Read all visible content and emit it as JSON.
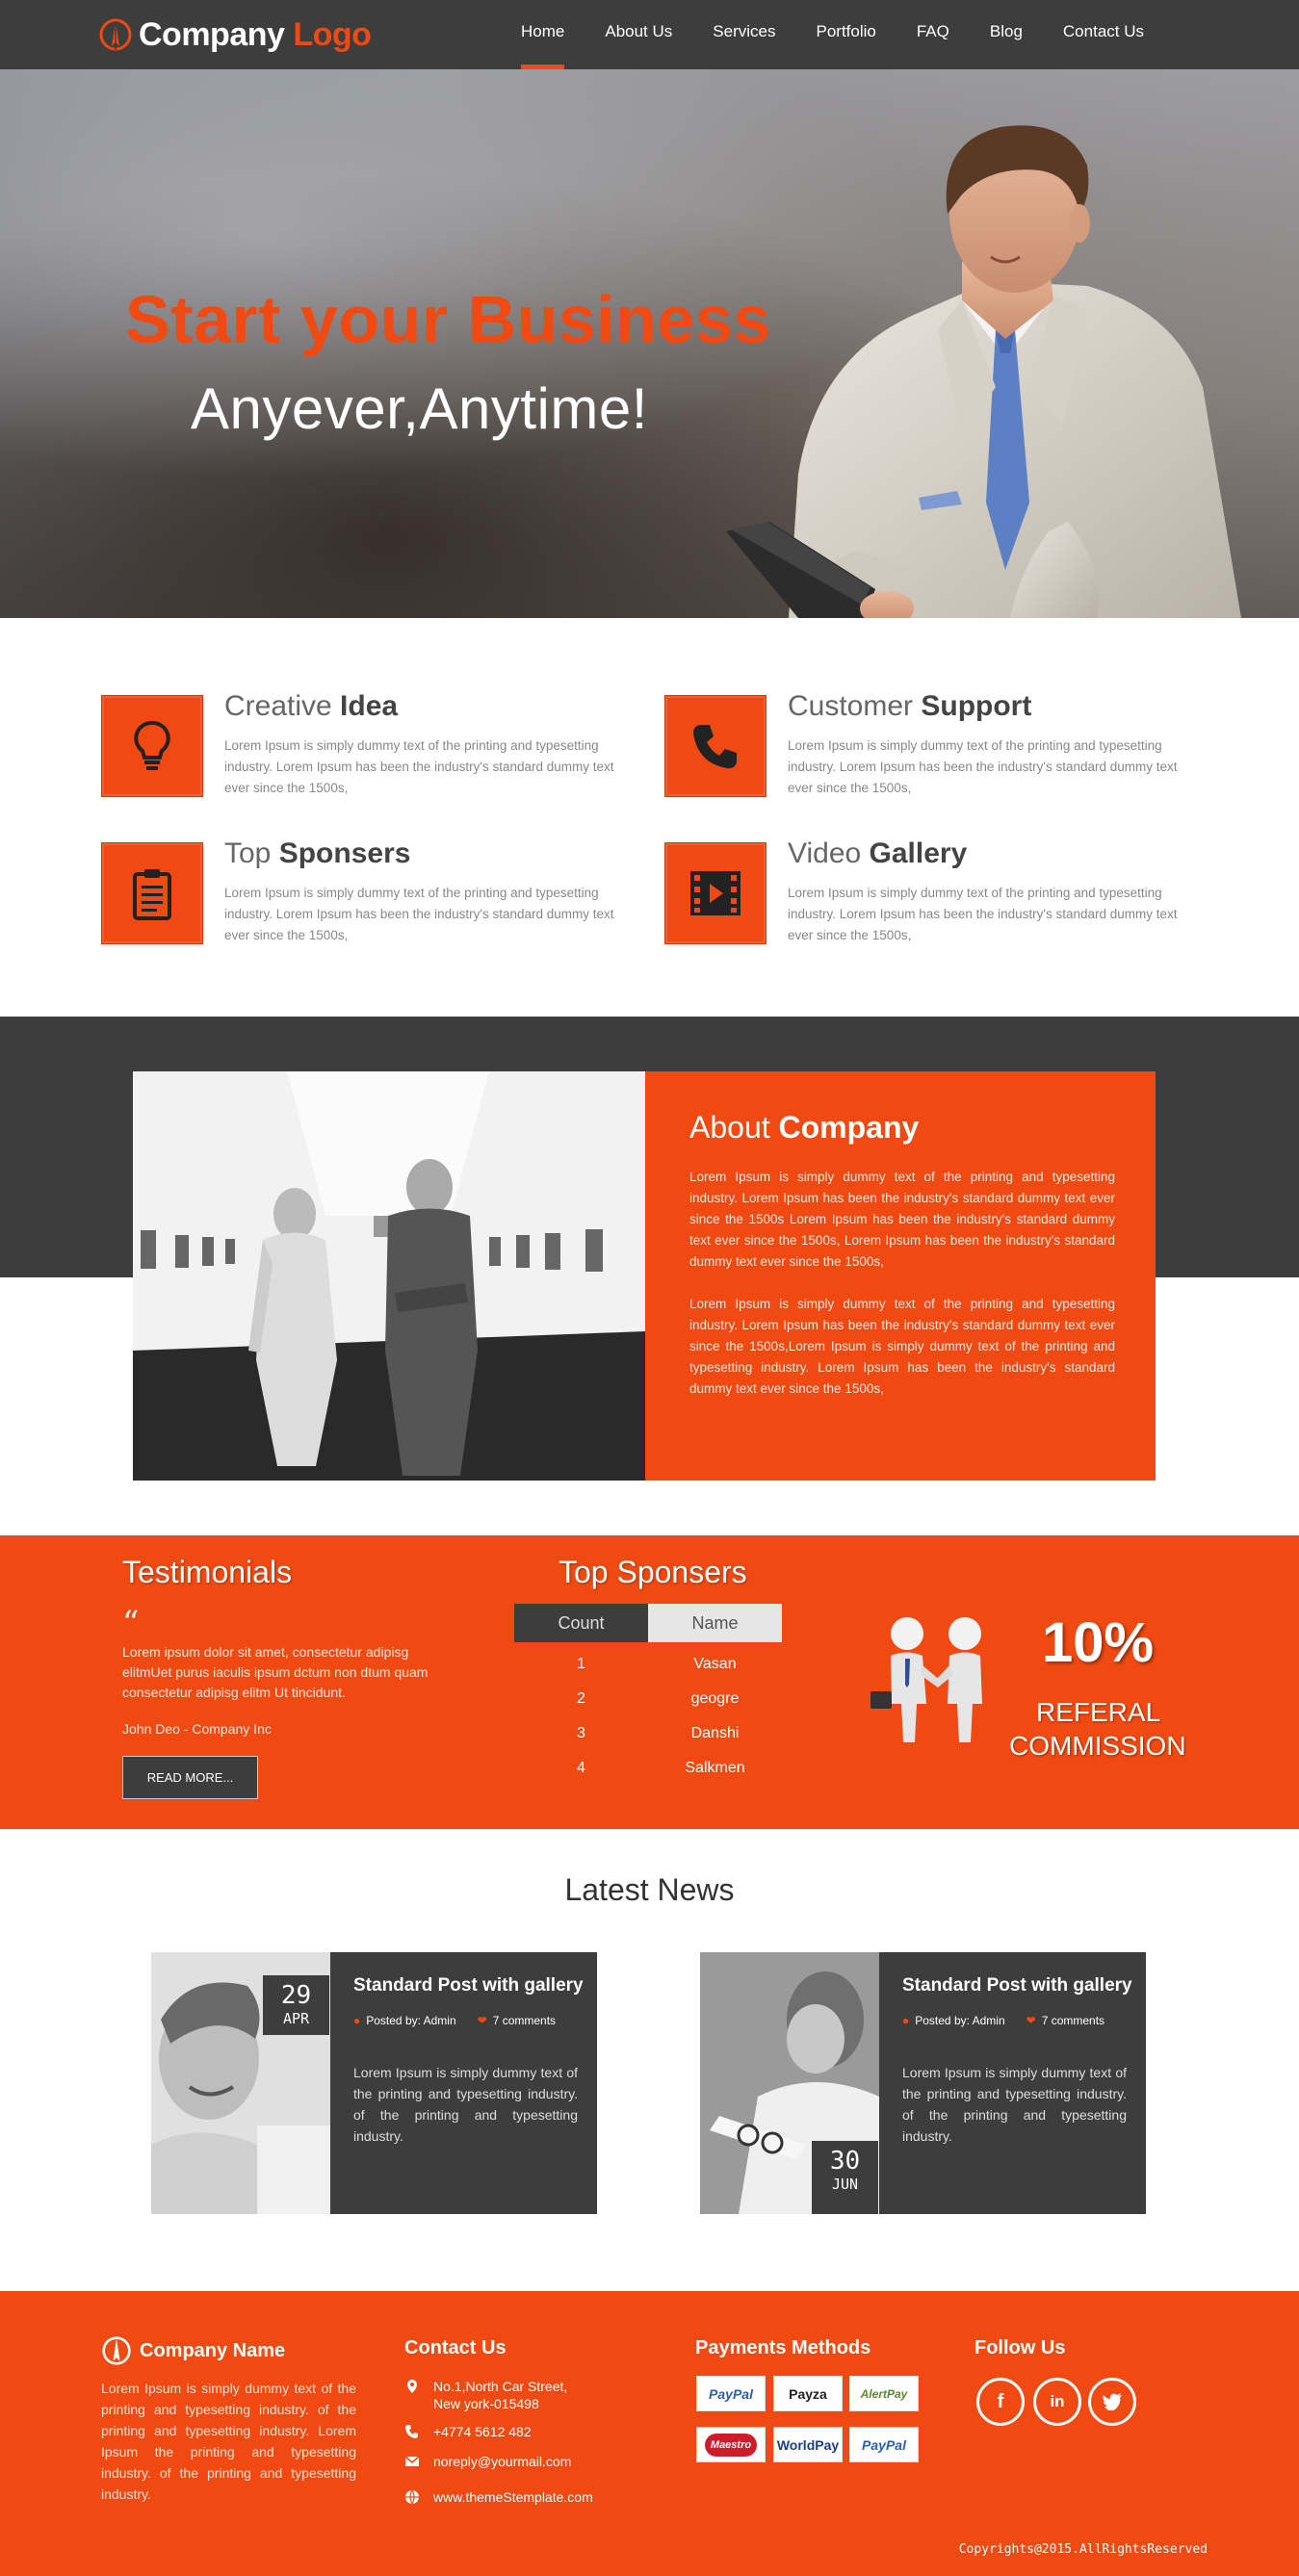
{
  "nav": {
    "logo_part1": "Company",
    "logo_part2": "Logo",
    "items": [
      "Home",
      "About Us",
      "Services",
      "Portfolio",
      "FAQ",
      "Blog",
      "Contact Us"
    ]
  },
  "hero": {
    "title": "Start your Business",
    "subtitle": "Anyever,Anytime!"
  },
  "features": [
    {
      "light": "Creative ",
      "bold": "Idea",
      "text": "Lorem Ipsum is simply dummy text of the printing and typesetting industry. Lorem Ipsum has been the industry's standard dummy text ever since the 1500s,"
    },
    {
      "light": "Customer ",
      "bold": "Support",
      "text": "Lorem Ipsum is simply dummy text of the printing and typesetting industry. Lorem Ipsum has been the industry's standard dummy text ever since the 1500s,"
    },
    {
      "light": "Top ",
      "bold": "Sponsers",
      "text": "Lorem Ipsum is simply dummy text of the printing and typesetting industry. Lorem Ipsum has been the industry's standard dummy text ever since the 1500s,"
    },
    {
      "light": "Video ",
      "bold": "Gallery",
      "text": "Lorem Ipsum is simply dummy text of the printing and typesetting industry. Lorem Ipsum has been the industry's standard dummy text ever since the 1500s,"
    }
  ],
  "about": {
    "title_light": "About ",
    "title_bold": "Company",
    "para1": "Lorem Ipsum is simply dummy text of the printing and typesetting industry. Lorem Ipsum has been the industry's standard dummy text ever since the 1500s Lorem Ipsum has been the industry's standard dummy text ever since the 1500s, Lorem Ipsum has been the industry's standard dummy text ever since the 1500s,",
    "para2": "Lorem Ipsum is simply dummy text of the printing and typesetting industry. Lorem Ipsum has been the industry's standard dummy text ever since the 1500s,Lorem Ipsum is simply dummy text of the printing and typesetting industry. Lorem Ipsum has been the industry's standard dummy text ever since the 1500s,"
  },
  "testimonials": {
    "title": "Testimonials",
    "quote_mark": "“",
    "text": "Lorem ipsum dolor sit amet, consectetur adipisg elitmUet purus iaculis ipsum dctum non dtum quam consectetur adipisg elitm Ut tincidunt.",
    "author": "John Deo - Company Inc",
    "button": "READ MORE..."
  },
  "sponsers": {
    "title": "Top Sponsers",
    "col1": "Count",
    "col2": "Name",
    "rows": [
      {
        "count": "1",
        "name": "Vasan"
      },
      {
        "count": "2",
        "name": "geogre"
      },
      {
        "count": "3",
        "name": "Danshi"
      },
      {
        "count": "4",
        "name": "Salkmen"
      }
    ]
  },
  "referal": {
    "percent": "10%",
    "line1": "REFERAL",
    "line2": "COMMISSION"
  },
  "news": {
    "title": "Latest News",
    "cards": [
      {
        "title": "Standard Post with gallery",
        "posted": "Posted by: Admin",
        "comments": "7 comments",
        "text": "Lorem Ipsum is simply dummy text of the printing and typesetting industry. of the printing and typesetting industry.",
        "day": "29",
        "month": "APR"
      },
      {
        "title": "Standard Post with gallery",
        "posted": "Posted by: Admin",
        "comments": "7 comments",
        "text": "Lorem Ipsum is simply dummy text of the printing and typesetting industry. of the printing and typesetting industry.",
        "day": "30",
        "month": "JUN"
      }
    ]
  },
  "footer": {
    "company_title": "Company Name",
    "company_text": "Lorem Ipsum is simply dummy text of the printing and typesetting industry. of the printing and typesetting industry. Lorem Ipsum the printing and typesetting industry. of the printing and typesetting industry.",
    "contact_title": "Contact Us",
    "address_line1": "No.1,North Car Street,",
    "address_line2": "New york-015498",
    "phone": "+4774 5612 482",
    "email": "noreply@yourmail.com",
    "website": "www.themeStemplate.com",
    "payments_title": "Payments Methods",
    "payments": [
      "PayPal",
      "Payza",
      "AlertPay",
      "Maestro",
      "WorldPay",
      "PayPal"
    ],
    "follow_title": "Follow Us",
    "social": [
      "f",
      "in",
      "twitter-bird"
    ],
    "copyright": "Copyrights@2015.AllRightsReserved"
  },
  "colors": {
    "accent": "#f04a12",
    "dark": "#3d3d3d"
  }
}
